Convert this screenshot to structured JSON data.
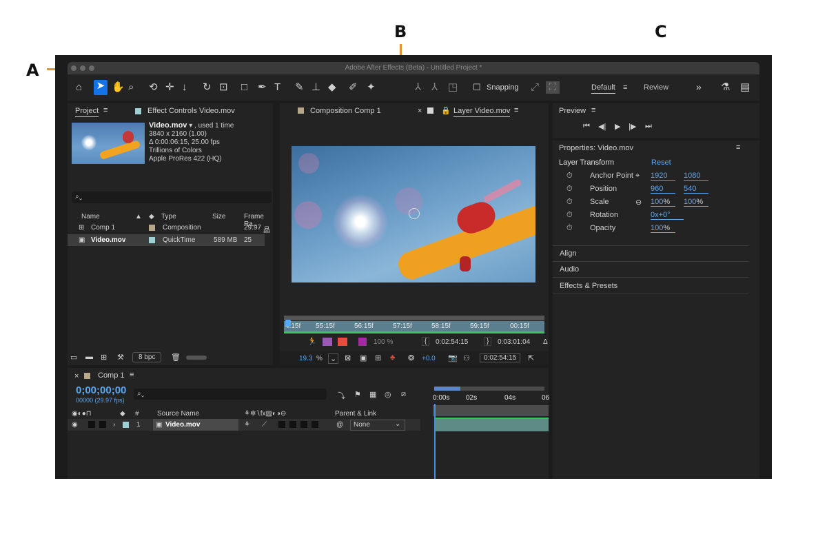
{
  "callouts": {
    "a": "A",
    "b": "B",
    "c": "C"
  },
  "window": {
    "title": "Adobe After Effects (Beta) - Untitled Project *"
  },
  "toolbar": {
    "snapping_label": "Snapping",
    "workspace_default": "Default",
    "workspace_review": "Review",
    "more_glyph": "»"
  },
  "project": {
    "tab_project": "Project",
    "tab_effect_controls": "Effect Controls Video.mov",
    "file_name": "Video.mov",
    "file_used": ", used 1 time",
    "file_res": "3840 x 2160 (1.00)",
    "file_duration": "Δ 0:00:06:15, 25.00 fps",
    "file_colors": "Trillions of Colors",
    "file_codec": "Apple ProRes 422 (HQ)",
    "columns": {
      "name": "Name",
      "type": "Type",
      "size": "Size",
      "frame_rate": "Frame Ra.."
    },
    "items": [
      {
        "name": "Comp 1",
        "type": "Composition",
        "size": "",
        "rate": "29.97",
        "color": "#b6a78a"
      },
      {
        "name": "Video.mov",
        "type": "QuickTime",
        "size": "589 MB",
        "rate": "25",
        "color": "#9fcfd3"
      }
    ],
    "bpc": "8 bpc"
  },
  "composition": {
    "tab_comp": "Composition Comp 1",
    "tab_layer": "Layer Video.mov",
    "ruler_ticks": [
      "4:15f",
      "55:15f",
      "56:15f",
      "57:15f",
      "58:15f",
      "59:15f",
      "00:15f"
    ],
    "opacity_value": "100 %",
    "in_point": "0:02:54:15",
    "out_point": "0:03:01:04",
    "zoom": "19.3",
    "zoom_unit": "%",
    "exposure": "+0.0",
    "current_time": "0:02:54:15"
  },
  "preview": {
    "title": "Preview"
  },
  "properties": {
    "title": "Properties: Video.mov",
    "section": "Layer Transform",
    "reset": "Reset",
    "rows": [
      {
        "label": "Anchor Point",
        "v1": "1920",
        "v2": "1080"
      },
      {
        "label": "Position",
        "v1": "960",
        "v2": "540"
      },
      {
        "label": "Scale",
        "v1": "100",
        "v1_unit": "%",
        "v2": "100",
        "v2_unit": "%"
      },
      {
        "label": "Rotation",
        "v1": "0x+0°"
      },
      {
        "label": "Opacity",
        "v1": "100",
        "v1_unit": "%"
      }
    ],
    "panels": [
      "Align",
      "Audio",
      "Effects & Presets"
    ]
  },
  "timeline": {
    "tab": "Comp 1",
    "timecode": "0;00;00;00",
    "timecode_sub": "00000 (29.97 fps)",
    "col_source": "Source Name",
    "col_parent": "Parent & Link",
    "col_hash": "#",
    "ruler": [
      "0:00s",
      "02s",
      "04s",
      "06"
    ],
    "layer": {
      "index": "1",
      "name": "Video.mov",
      "parent": "None"
    }
  }
}
